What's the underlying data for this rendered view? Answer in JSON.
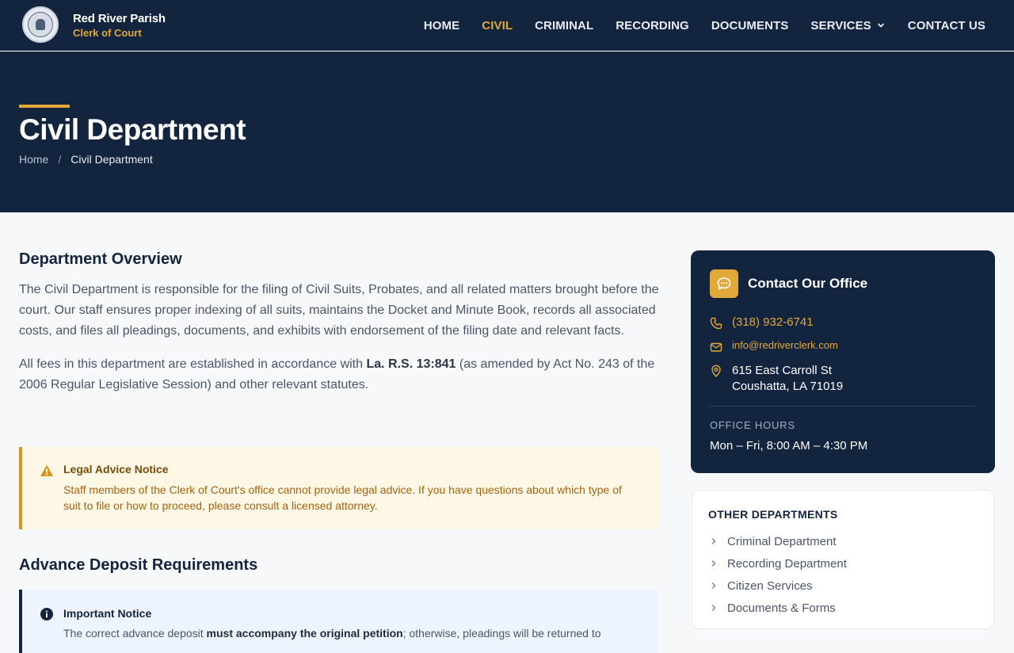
{
  "header": {
    "brand_title": "Red River Parish",
    "brand_subtitle": "Clerk of Court",
    "nav": [
      {
        "label": "HOME"
      },
      {
        "label": "CIVIL",
        "active": true
      },
      {
        "label": "CRIMINAL"
      },
      {
        "label": "RECORDING"
      },
      {
        "label": "DOCUMENTS"
      },
      {
        "label": "SERVICES",
        "has_dropdown": true
      },
      {
        "label": "CONTACT US"
      }
    ]
  },
  "hero": {
    "title": "Civil Department",
    "breadcrumb": {
      "home": "Home",
      "separator": "/",
      "current": "Civil Department"
    }
  },
  "overview": {
    "heading": "Department Overview",
    "paragraph1": "The Civil Department is responsible for the filing of Civil Suits, Probates, and all related matters brought before the court. Our staff ensures proper indexing of all suits, maintains the Docket and Minute Book, records all associated costs, and files all pleadings, documents, and exhibits with endorsement of the filing date and relevant facts.",
    "paragraph2_before": "All fees in this department are established in accordance with ",
    "paragraph2_bold": "La. R.S. 13:841",
    "paragraph2_after": " (as amended by Act No. 243 of the 2006 Regular Legislative Session) and other relevant statutes."
  },
  "legal_notice": {
    "icon": "warning-icon",
    "title": "Legal Advice Notice",
    "text": "Staff members of the Clerk of Court's office cannot provide legal advice. If you have questions about which type of suit to file or how to proceed, please consult a licensed attorney."
  },
  "deposit": {
    "heading": "Advance Deposit Requirements"
  },
  "important_notice": {
    "icon": "info-icon",
    "title": "Important Notice",
    "text_before": "The correct advance deposit ",
    "text_bold": "must accompany the original petition",
    "text_after": "; otherwise, pleadings will be returned to"
  },
  "contact": {
    "icon": "chat-icon",
    "heading": "Contact Our Office",
    "phone": "(318) 932-6741",
    "email": "info@redriverclerk.com",
    "address_line1": "615 East Carroll St",
    "address_line2": "Coushatta, LA 71019",
    "hours_label": "OFFICE HOURS",
    "hours": "Mon – Fri, 8:00 AM – 4:30 PM"
  },
  "other_departments": {
    "heading": "OTHER DEPARTMENTS",
    "items": [
      {
        "label": "Criminal Department"
      },
      {
        "label": "Recording Department"
      },
      {
        "label": "Citizen Services"
      },
      {
        "label": "Documents & Forms"
      }
    ]
  },
  "colors": {
    "navy": "#13243f",
    "gold": "#e2a83a",
    "warning_bg": "#fdf8e6",
    "info_bg": "#eef4fd"
  }
}
